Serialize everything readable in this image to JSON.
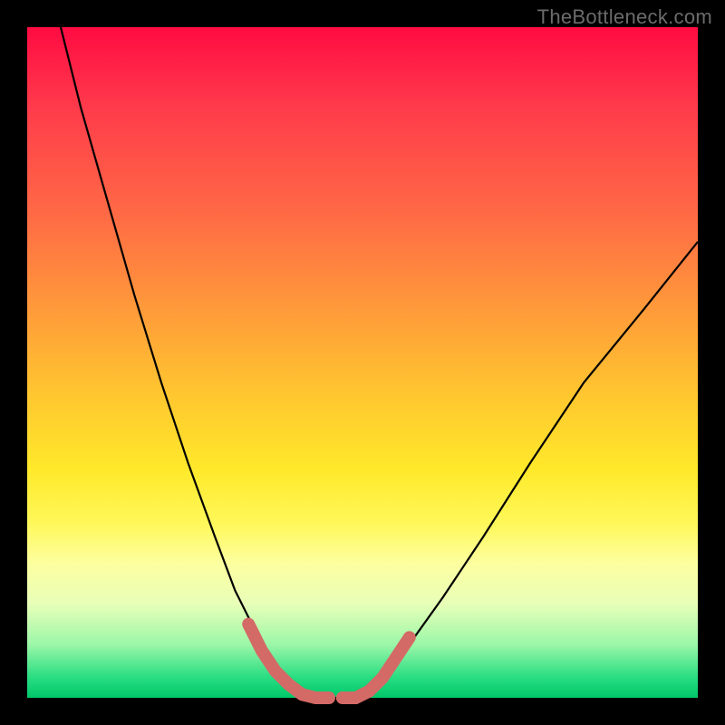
{
  "watermark": "TheBottleneck.com",
  "colors": {
    "page_bg": "#000000",
    "watermark_text": "#6b6b6b",
    "curve_stroke": "#000000",
    "marker_stroke": "#d46a66",
    "gradient_top": "#ff0b42",
    "gradient_bottom": "#00c76a"
  },
  "chart_data": {
    "type": "line",
    "title": "",
    "xlabel": "",
    "ylabel": "",
    "xlim": [
      0,
      100
    ],
    "ylim": [
      0,
      100
    ],
    "grid": false,
    "legend": false,
    "series": [
      {
        "name": "left-curve",
        "x": [
          5,
          8,
          12,
          16,
          20,
          24,
          28,
          31,
          34,
          36,
          38,
          40,
          42
        ],
        "y": [
          100,
          88,
          74,
          60,
          47,
          35,
          24,
          16,
          10,
          6,
          3,
          1,
          0
        ]
      },
      {
        "name": "valley-floor",
        "x": [
          42,
          44,
          46,
          48,
          50
        ],
        "y": [
          0,
          0,
          0,
          0,
          0
        ]
      },
      {
        "name": "right-curve",
        "x": [
          50,
          53,
          57,
          62,
          68,
          75,
          83,
          92,
          100
        ],
        "y": [
          0,
          3,
          8,
          15,
          24,
          35,
          47,
          58,
          68
        ]
      }
    ],
    "markers": [
      {
        "name": "left-descent-marker",
        "x": [
          33,
          35,
          37,
          39,
          41
        ],
        "y": [
          11,
          7,
          4,
          2,
          0.5
        ]
      },
      {
        "name": "valley-left-marker",
        "x": [
          41,
          43,
          45
        ],
        "y": [
          0.5,
          0,
          0
        ]
      },
      {
        "name": "valley-right-marker",
        "x": [
          47,
          49,
          51
        ],
        "y": [
          0,
          0,
          1
        ]
      },
      {
        "name": "right-ascent-marker",
        "x": [
          51,
          53,
          55,
          57
        ],
        "y": [
          1,
          3,
          6,
          9
        ]
      }
    ]
  }
}
